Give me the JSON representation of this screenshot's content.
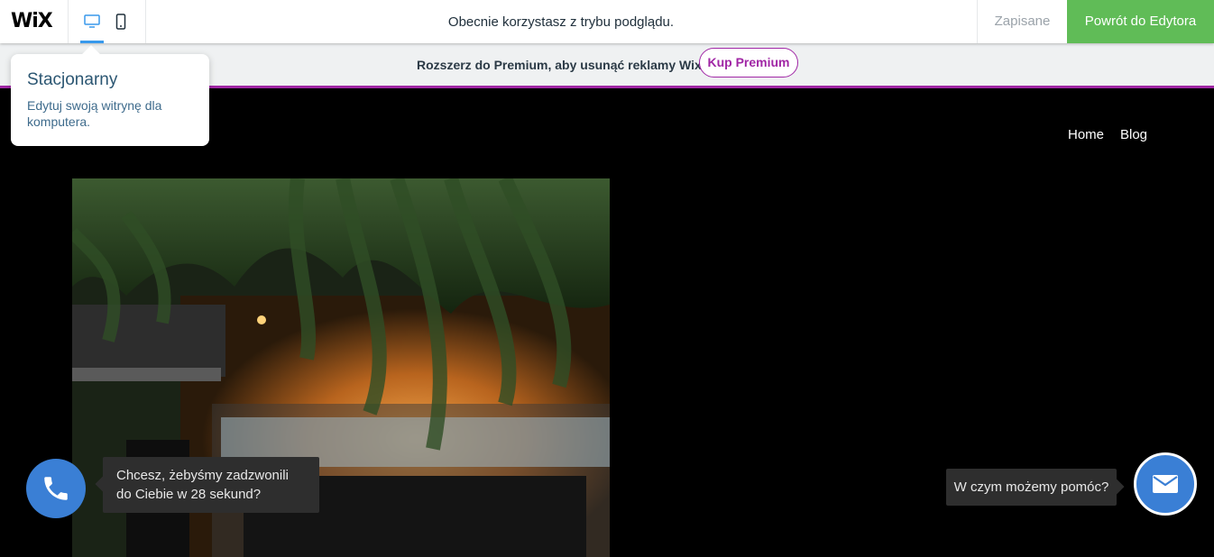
{
  "topbar": {
    "logo": "WiX",
    "devices": [
      {
        "name": "desktop",
        "icon": "desktop-icon",
        "active": true
      },
      {
        "name": "mobile",
        "icon": "mobile-icon",
        "active": false
      }
    ],
    "preview_message": "Obecnie korzystasz z trybu podglądu.",
    "saved_label": "Zapisane",
    "back_button_label": "Powrót do Edytora"
  },
  "banner": {
    "text": "Rozszerz do Premium, aby usunąć reklamy Wix",
    "button_label": "Kup Premium"
  },
  "tooltip": {
    "title": "Stacjonarny",
    "description": "Edytuj swoją witrynę dla komputera."
  },
  "site": {
    "nav": [
      "Home",
      "Blog"
    ]
  },
  "call_widget": {
    "icon": "phone-icon",
    "message": "Chcesz, żebyśmy zadzwonili do Ciebie w 28 sekund?"
  },
  "chat_widget": {
    "icon": "envelope-icon",
    "message": "W czym możemy pomóc?"
  },
  "colors": {
    "accent_blue": "#3899ec",
    "editor_green": "#60bc57",
    "premium_purple": "#a026a5",
    "widget_blue": "#3a7fd5"
  }
}
